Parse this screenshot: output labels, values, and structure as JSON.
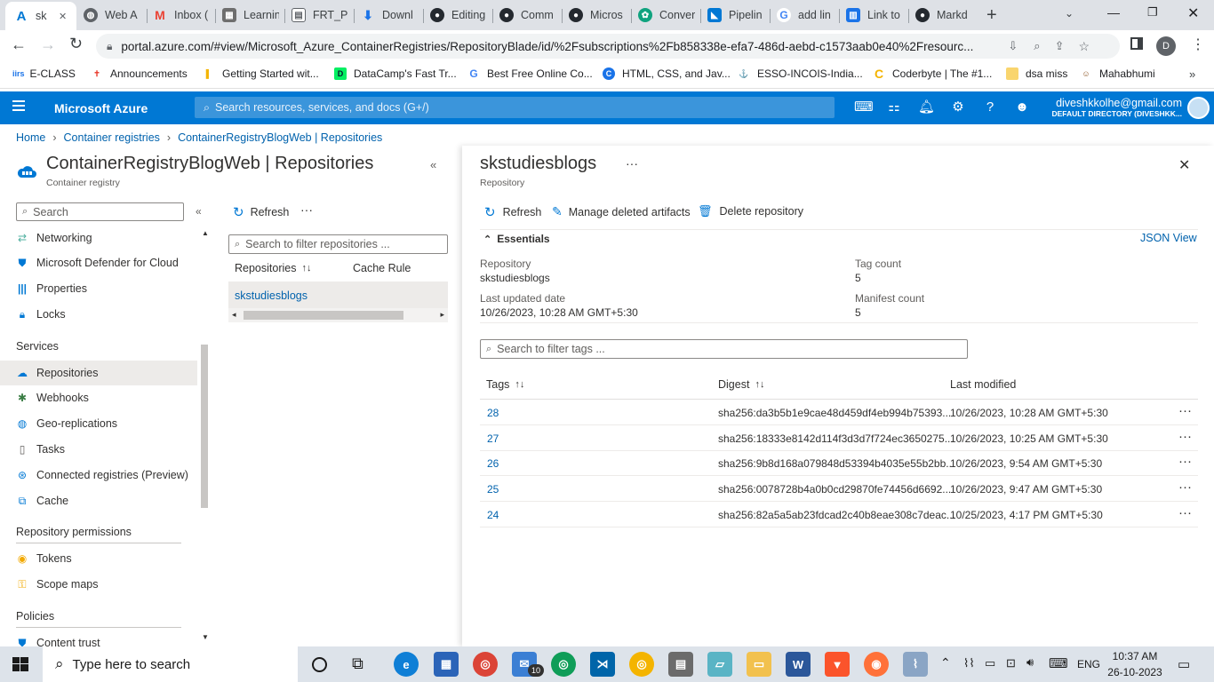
{
  "browser": {
    "tabs": [
      {
        "label": "sk",
        "icon": "azure-icon",
        "active": true
      },
      {
        "label": "Web A",
        "icon": "globe-icon"
      },
      {
        "label": "Inbox (",
        "icon": "gmail-icon"
      },
      {
        "label": "Learnin",
        "icon": "learning-icon"
      },
      {
        "label": "FRT_Pr",
        "icon": "document-icon"
      },
      {
        "label": "Downl",
        "icon": "download-icon"
      },
      {
        "label": "Editing",
        "icon": "github-icon"
      },
      {
        "label": "Comm",
        "icon": "github-icon"
      },
      {
        "label": "Micros",
        "icon": "github-icon"
      },
      {
        "label": "Conver",
        "icon": "chatgpt-icon"
      },
      {
        "label": "Pipelin",
        "icon": "azure-devops-icon"
      },
      {
        "label": "add lin",
        "icon": "google-icon"
      },
      {
        "label": "Link to",
        "icon": "book-icon"
      },
      {
        "label": "Markd",
        "icon": "github-icon"
      }
    ],
    "url": "portal.azure.com/#view/Microsoft_Azure_ContainerRegistries/RepositoryBlade/id/%2Fsubscriptions%2Fb858338e-efa7-486d-aebd-c1573aab0e40%2Fresourc...",
    "profile_initial": "D",
    "bookmarks": [
      {
        "label": "E-CLASS"
      },
      {
        "label": "Announcements"
      },
      {
        "label": "Getting Started wit..."
      },
      {
        "label": "DataCamp's Fast Tr..."
      },
      {
        "label": "Best Free Online Co..."
      },
      {
        "label": "HTML, CSS, and Jav..."
      },
      {
        "label": "ESSO-INCOIS-India..."
      },
      {
        "label": "Coderbyte | The #1..."
      },
      {
        "label": "dsa miss"
      },
      {
        "label": "Mahabhumi"
      }
    ]
  },
  "azure": {
    "brand": "Microsoft Azure",
    "search_placeholder": "Search resources, services, and docs (G+/)",
    "user_email": "diveshkkolhe@gmail.com",
    "user_directory": "DEFAULT DIRECTORY (DIVESHKK..."
  },
  "breadcrumb": [
    "Home",
    "Container registries",
    "ContainerRegistryBlogWeb | Repositories"
  ],
  "left_blade": {
    "title": "ContainerRegistryBlogWeb | Repositories",
    "subtitle": "Container registry",
    "search_placeholder": "Search",
    "items_top": [
      {
        "label": "Networking",
        "icon": "networking-icon"
      },
      {
        "label": "Microsoft Defender for Cloud",
        "icon": "shield-icon"
      },
      {
        "label": "Properties",
        "icon": "properties-icon"
      },
      {
        "label": "Locks",
        "icon": "lock-icon"
      }
    ],
    "services_header": "Services",
    "services": [
      {
        "label": "Repositories",
        "icon": "cloud-icon",
        "selected": true
      },
      {
        "label": "Webhooks",
        "icon": "webhook-icon"
      },
      {
        "label": "Geo-replications",
        "icon": "globe-icon"
      },
      {
        "label": "Tasks",
        "icon": "tasks-icon"
      },
      {
        "label": "Connected registries (Preview)",
        "icon": "connected-icon"
      },
      {
        "label": "Cache",
        "icon": "cache-icon"
      }
    ],
    "permissions_header": "Repository permissions",
    "permissions": [
      {
        "label": "Tokens",
        "icon": "token-icon"
      },
      {
        "label": "Scope maps",
        "icon": "scope-icon"
      }
    ],
    "policies_header": "Policies",
    "policies": [
      {
        "label": "Content trust",
        "icon": "trust-icon"
      }
    ]
  },
  "repo_list": {
    "refresh": "Refresh",
    "filter_placeholder": "Search to filter repositories ...",
    "col_repositories": "Repositories",
    "col_cache_rule": "Cache Rule",
    "items": [
      "skstudiesblogs"
    ]
  },
  "detail": {
    "title": "skstudiesblogs",
    "subtitle": "Repository",
    "toolbar": {
      "refresh": "Refresh",
      "manage_deleted": "Manage deleted artifacts",
      "delete_repo": "Delete repository"
    },
    "essentials_label": "Essentials",
    "json_view": "JSON View",
    "fields": {
      "repository_label": "Repository",
      "repository_value": "skstudiesblogs",
      "last_updated_label": "Last updated date",
      "last_updated_value": "10/26/2023, 10:28 AM GMT+5:30",
      "tag_count_label": "Tag count",
      "tag_count_value": "5",
      "manifest_count_label": "Manifest count",
      "manifest_count_value": "5"
    },
    "tag_filter_placeholder": "Search to filter tags ...",
    "columns": {
      "tags": "Tags",
      "digest": "Digest",
      "last_modified": "Last modified"
    },
    "tags": [
      {
        "tag": "28",
        "digest": "sha256:da3b5b1e9cae48d459df4eb994b75393...",
        "modified": "10/26/2023, 10:28 AM GMT+5:30"
      },
      {
        "tag": "27",
        "digest": "sha256:18333e8142d114f3d3d7f724ec3650275...",
        "modified": "10/26/2023, 10:25 AM GMT+5:30"
      },
      {
        "tag": "26",
        "digest": "sha256:9b8d168a079848d53394b4035e55b2bb...",
        "modified": "10/26/2023, 9:54 AM GMT+5:30"
      },
      {
        "tag": "25",
        "digest": "sha256:0078728b4a0b0cd29870fe74456d6692...",
        "modified": "10/26/2023, 9:47 AM GMT+5:30"
      },
      {
        "tag": "24",
        "digest": "sha256:82a5a5ab23fdcad2c40b8eae308c7deac...",
        "modified": "10/25/2023, 4:17 PM GMT+5:30"
      }
    ],
    "more": "···"
  },
  "taskbar": {
    "search_placeholder": "Type here to search",
    "language": "ENG",
    "time": "10:37 AM",
    "date": "26-10-2023",
    "mail_badge": "10"
  }
}
